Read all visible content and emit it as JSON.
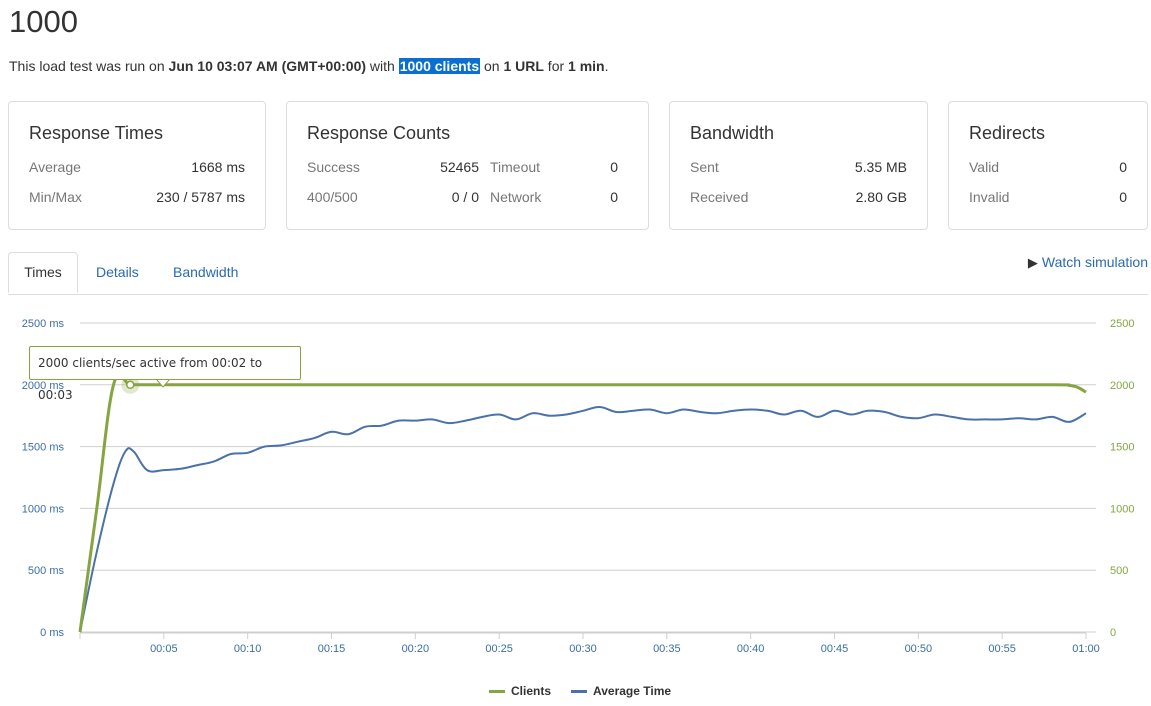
{
  "title": "1000",
  "summary": {
    "p1": "This load test was run on ",
    "date": "Jun 10 03:07 AM (GMT+00:00)",
    "p2": " with ",
    "clients": "1000 clients",
    "p3": " on ",
    "urls": "1 URL",
    "p4": " for ",
    "duration": "1 min",
    "p5": "."
  },
  "cards": {
    "response_times": {
      "title": "Response Times",
      "avg_label": "Average",
      "avg_value": "1668 ms",
      "minmax_label": "Min/Max",
      "minmax_value": "230 / 5787 ms"
    },
    "response_counts": {
      "title": "Response Counts",
      "success_label": "Success",
      "success_value": "52465",
      "timeout_label": "Timeout",
      "timeout_value": "0",
      "err_label": "400/500",
      "err_value": "0 / 0",
      "network_label": "Network",
      "network_value": "0"
    },
    "bandwidth": {
      "title": "Bandwidth",
      "sent_label": "Sent",
      "sent_value": "5.35 MB",
      "recv_label": "Received",
      "recv_value": "2.80 GB"
    },
    "redirects": {
      "title": "Redirects",
      "valid_label": "Valid",
      "valid_value": "0",
      "invalid_label": "Invalid",
      "invalid_value": "0"
    }
  },
  "tabs": [
    "Times",
    "Details",
    "Bandwidth"
  ],
  "watch_label": "Watch simulation",
  "tooltip": "2000 clients/sec active from 00:02 to 00:03",
  "chart_data": {
    "type": "line",
    "x_ticks": [
      "00:05",
      "00:10",
      "00:15",
      "00:20",
      "00:25",
      "00:30",
      "00:35",
      "00:40",
      "00:45",
      "00:50",
      "00:55",
      "01:00"
    ],
    "left_ticks": [
      "0 ms",
      "500 ms",
      "1000 ms",
      "1500 ms",
      "2000 ms",
      "2500 ms"
    ],
    "right_ticks": [
      "0",
      "500",
      "1000",
      "1500",
      "2000",
      "2500"
    ],
    "ylim": [
      0,
      2500
    ],
    "xlim": [
      0,
      60
    ],
    "colors": {
      "clients": "#86a541",
      "avg": "#4a72a8"
    },
    "series": [
      {
        "name": "Clients",
        "x": [
          0,
          1,
          2,
          3,
          4,
          5,
          10,
          20,
          30,
          40,
          50,
          58,
          59,
          59.5,
          60
        ],
        "values": [
          0,
          1000,
          2000,
          2000,
          2000,
          2000,
          2000,
          2000,
          2000,
          2000,
          2000,
          2000,
          1995,
          1980,
          1940
        ]
      },
      {
        "name": "Average Time",
        "x": [
          0,
          1,
          2,
          2.7,
          3.2,
          4,
          5,
          6,
          7,
          8,
          9,
          10,
          11,
          12,
          13,
          14,
          15,
          16,
          17,
          18,
          19,
          20,
          21,
          22,
          23,
          24,
          25,
          26,
          27,
          28,
          29,
          30,
          31,
          32,
          33,
          34,
          35,
          36,
          37,
          38,
          39,
          40,
          41,
          42,
          43,
          44,
          45,
          46,
          47,
          48,
          49,
          50,
          51,
          52,
          53,
          54,
          55,
          56,
          57,
          58,
          59,
          60
        ],
        "values": [
          0,
          650,
          1200,
          1460,
          1460,
          1310,
          1310,
          1320,
          1350,
          1380,
          1440,
          1450,
          1500,
          1510,
          1540,
          1570,
          1620,
          1600,
          1660,
          1670,
          1710,
          1710,
          1720,
          1690,
          1710,
          1740,
          1760,
          1720,
          1770,
          1750,
          1760,
          1790,
          1820,
          1780,
          1790,
          1800,
          1770,
          1800,
          1780,
          1770,
          1790,
          1800,
          1790,
          1760,
          1790,
          1740,
          1790,
          1760,
          1790,
          1780,
          1740,
          1730,
          1760,
          1740,
          1720,
          1720,
          1720,
          1730,
          1720,
          1740,
          1700,
          1770
        ]
      }
    ],
    "marker": {
      "x": 3,
      "y": 2000
    }
  }
}
